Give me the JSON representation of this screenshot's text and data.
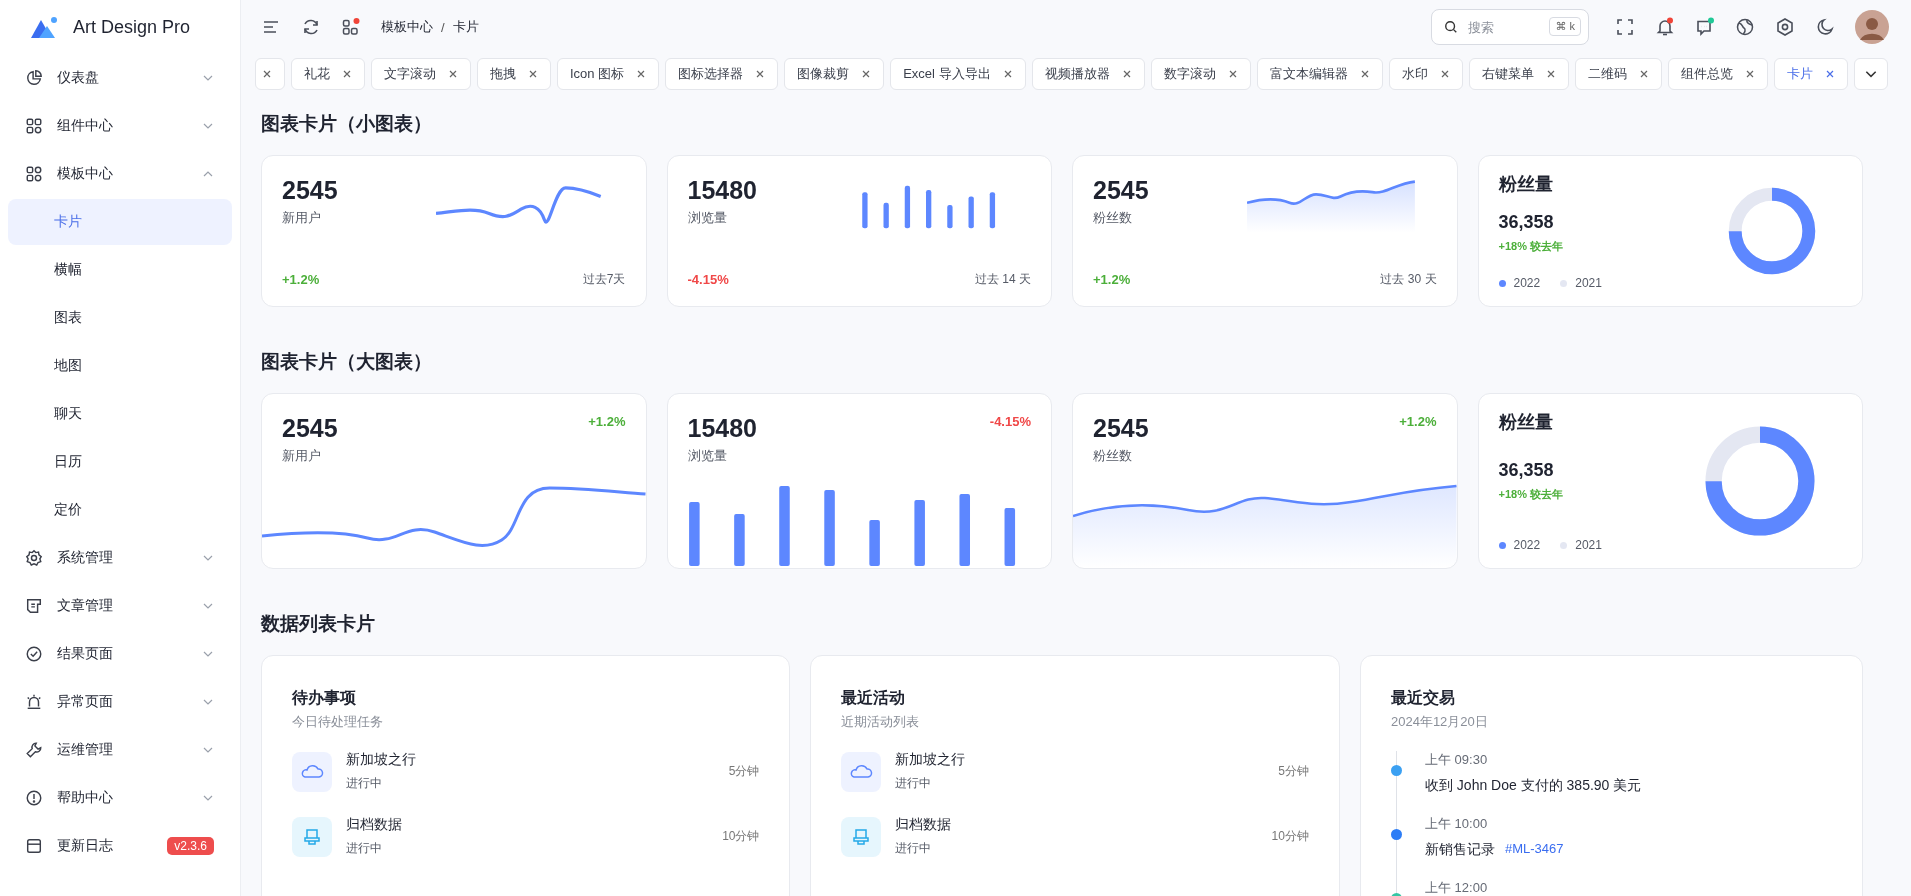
{
  "logo": {
    "title": "Art Design Pro"
  },
  "sidebar": {
    "items": [
      {
        "label": "仪表盘",
        "expanded": false
      },
      {
        "label": "组件中心",
        "expanded": false
      },
      {
        "label": "模板中心",
        "expanded": true,
        "children": [
          {
            "label": "卡片",
            "selected": true
          },
          {
            "label": "横幅",
            "selected": false
          },
          {
            "label": "图表",
            "selected": false
          },
          {
            "label": "地图",
            "selected": false
          },
          {
            "label": "聊天",
            "selected": false
          },
          {
            "label": "日历",
            "selected": false
          },
          {
            "label": "定价",
            "selected": false
          }
        ]
      },
      {
        "label": "系统管理",
        "expanded": false
      },
      {
        "label": "文章管理",
        "expanded": false
      },
      {
        "label": "结果页面",
        "expanded": false
      },
      {
        "label": "异常页面",
        "expanded": false
      },
      {
        "label": "运维管理",
        "expanded": false
      },
      {
        "label": "帮助中心",
        "expanded": false
      },
      {
        "label": "更新日志",
        "badge": "v2.3.6"
      }
    ]
  },
  "header": {
    "breadcrumb": {
      "items": [
        "模板中心",
        "卡片"
      ],
      "separator": "/"
    },
    "apps_unread": true,
    "search": {
      "placeholder": "搜索",
      "shortcut": "⌘ k"
    },
    "notifications_unread": true,
    "messages_unread": true
  },
  "tabs": [
    {
      "selected": false
    },
    {
      "label": "礼花",
      "selected": false
    },
    {
      "label": "文字滚动",
      "selected": false
    },
    {
      "label": "拖拽",
      "selected": false
    },
    {
      "label": "Icon 图标",
      "selected": false
    },
    {
      "label": "图标选择器",
      "selected": false
    },
    {
      "label": "图像裁剪",
      "selected": false
    },
    {
      "label": "Excel 导入导出",
      "selected": false
    },
    {
      "label": "视频播放器",
      "selected": false
    },
    {
      "label": "数字滚动",
      "selected": false
    },
    {
      "label": "富文本编辑器",
      "selected": false
    },
    {
      "label": "水印",
      "selected": false
    },
    {
      "label": "右键菜单",
      "selected": false
    },
    {
      "label": "二维码",
      "selected": false
    },
    {
      "label": "组件总览",
      "selected": false
    },
    {
      "label": "卡片",
      "selected": true
    }
  ],
  "small_section": {
    "title": "图表卡片（小图表）",
    "cards": [
      {
        "kind": "line",
        "value": "2545",
        "label": "新用户",
        "change": "+1.2%",
        "negative": false,
        "period": "过去7天"
      },
      {
        "kind": "bar",
        "value": "15480",
        "label": "浏览量",
        "change": "-4.15%",
        "negative": true,
        "period": "过去 14 天"
      },
      {
        "kind": "area",
        "value": "2545",
        "label": "粉丝数",
        "change": "+1.2%",
        "negative": false,
        "period": "过去 30 天"
      },
      {
        "kind": "donut",
        "title": "粉丝量",
        "value": "36,358",
        "change": "+18% 较去年",
        "legend": [
          {
            "label": "2022",
            "color": "#5d87ff"
          },
          {
            "label": "2021",
            "color": "#e4e7f2"
          }
        ]
      }
    ]
  },
  "large_section": {
    "title": "图表卡片（大图表）",
    "cards": [
      {
        "kind": "line",
        "value": "2545",
        "label": "新用户",
        "change": "+1.2%",
        "negative": false
      },
      {
        "kind": "bar",
        "value": "15480",
        "label": "浏览量",
        "change": "-4.15%",
        "negative": true
      },
      {
        "kind": "area",
        "value": "2545",
        "label": "粉丝数",
        "change": "+1.2%",
        "negative": false
      },
      {
        "kind": "donut",
        "title": "粉丝量",
        "value": "36,358",
        "change": "+18% 较去年",
        "legend": [
          {
            "label": "2022",
            "color": "#5d87ff"
          },
          {
            "label": "2021",
            "color": "#e4e7f2"
          }
        ]
      }
    ]
  },
  "list_section": {
    "title": "数据列表卡片",
    "todo": {
      "title": "待办事项",
      "subtitle": "今日待处理任务",
      "items": [
        {
          "kind": "cloud",
          "title": "新加坡之行",
          "status": "进行中",
          "time": "5分钟"
        },
        {
          "kind": "archive",
          "title": "归档数据",
          "status": "进行中",
          "time": "10分钟"
        }
      ]
    },
    "activity": {
      "title": "最近活动",
      "subtitle": "近期活动列表",
      "items": [
        {
          "kind": "cloud",
          "title": "新加坡之行",
          "status": "进行中",
          "time": "5分钟"
        },
        {
          "kind": "archive",
          "title": "归档数据",
          "status": "进行中",
          "time": "10分钟"
        }
      ]
    },
    "transactions": {
      "title": "最近交易",
      "subtitle": "2024年12月20日",
      "items": [
        {
          "time": "上午 09:30",
          "text": "收到 John Doe 支付的 385.90 美元",
          "color": "#3ba0f2"
        },
        {
          "time": "上午 10:00",
          "text": "新销售记录",
          "link": "#ML-3467",
          "color": "#2d7df6"
        },
        {
          "time": "上午 12:00",
          "color": "#35c7a5"
        }
      ]
    }
  }
}
